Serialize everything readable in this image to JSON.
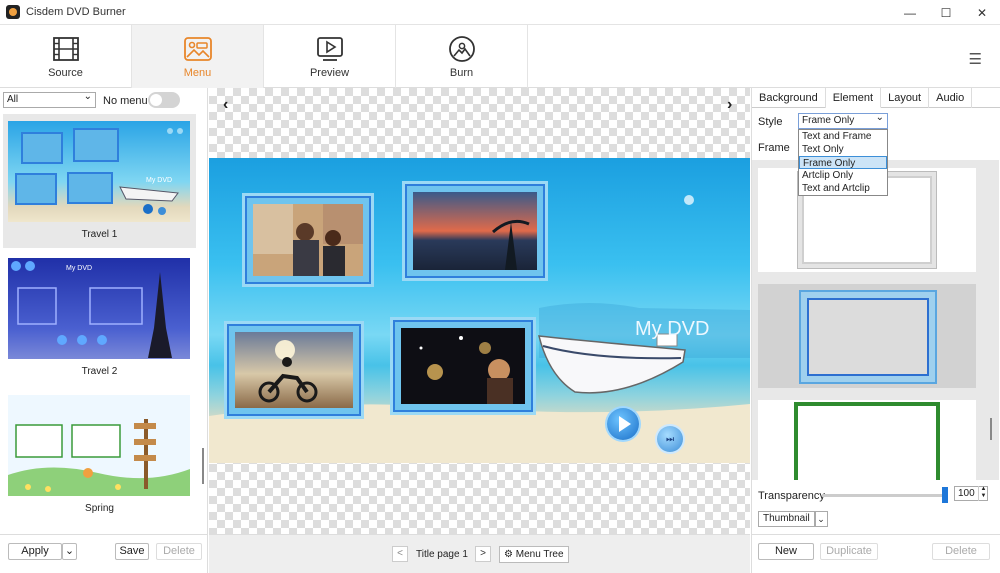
{
  "window": {
    "title": "Cisdem DVD Burner",
    "minimize": "—",
    "maximize": "☐",
    "close": "✕"
  },
  "toolbar": {
    "tabs": [
      {
        "label": "Source",
        "icon": "film-icon"
      },
      {
        "label": "Menu",
        "icon": "menu-template-icon"
      },
      {
        "label": "Preview",
        "icon": "play-screen-icon"
      },
      {
        "label": "Burn",
        "icon": "disc-icon"
      }
    ],
    "menu_icon": "☰"
  },
  "left": {
    "filter": "All",
    "no_menu_label": "No menu",
    "templates": [
      "Travel 1",
      "Travel 2",
      "Spring"
    ],
    "thumb_dvd_label": "My DVD",
    "apply": "Apply",
    "save": "Save",
    "delete": "Delete"
  },
  "center": {
    "prev": "‹",
    "next": "›",
    "menu_title": "My DVD",
    "next_chapter": "⏭",
    "page_prev": "<",
    "page_next": ">",
    "page_label": "Title page 1",
    "menu_tree": "Menu Tree",
    "menu_tree_icon": "⚙"
  },
  "right": {
    "tabs": [
      "Background",
      "Element",
      "Layout",
      "Audio"
    ],
    "style_label": "Style",
    "style_value": "Frame Only",
    "style_options": [
      "Text and Frame",
      "Text Only",
      "Frame Only",
      "Artclip Only",
      "Text and Artclip"
    ],
    "frame_label": "Frame",
    "transparency_label": "Transparency",
    "transparency_value": "100",
    "spin_up": "▲",
    "spin_down": "▼",
    "thumbnail": "Thumbnail",
    "thumbnail_arrow": "⌄",
    "new": "New",
    "duplicate": "Duplicate",
    "delete": "Delete"
  },
  "colors": {
    "accent": "#e8862a",
    "selection": "#1e77d9"
  }
}
